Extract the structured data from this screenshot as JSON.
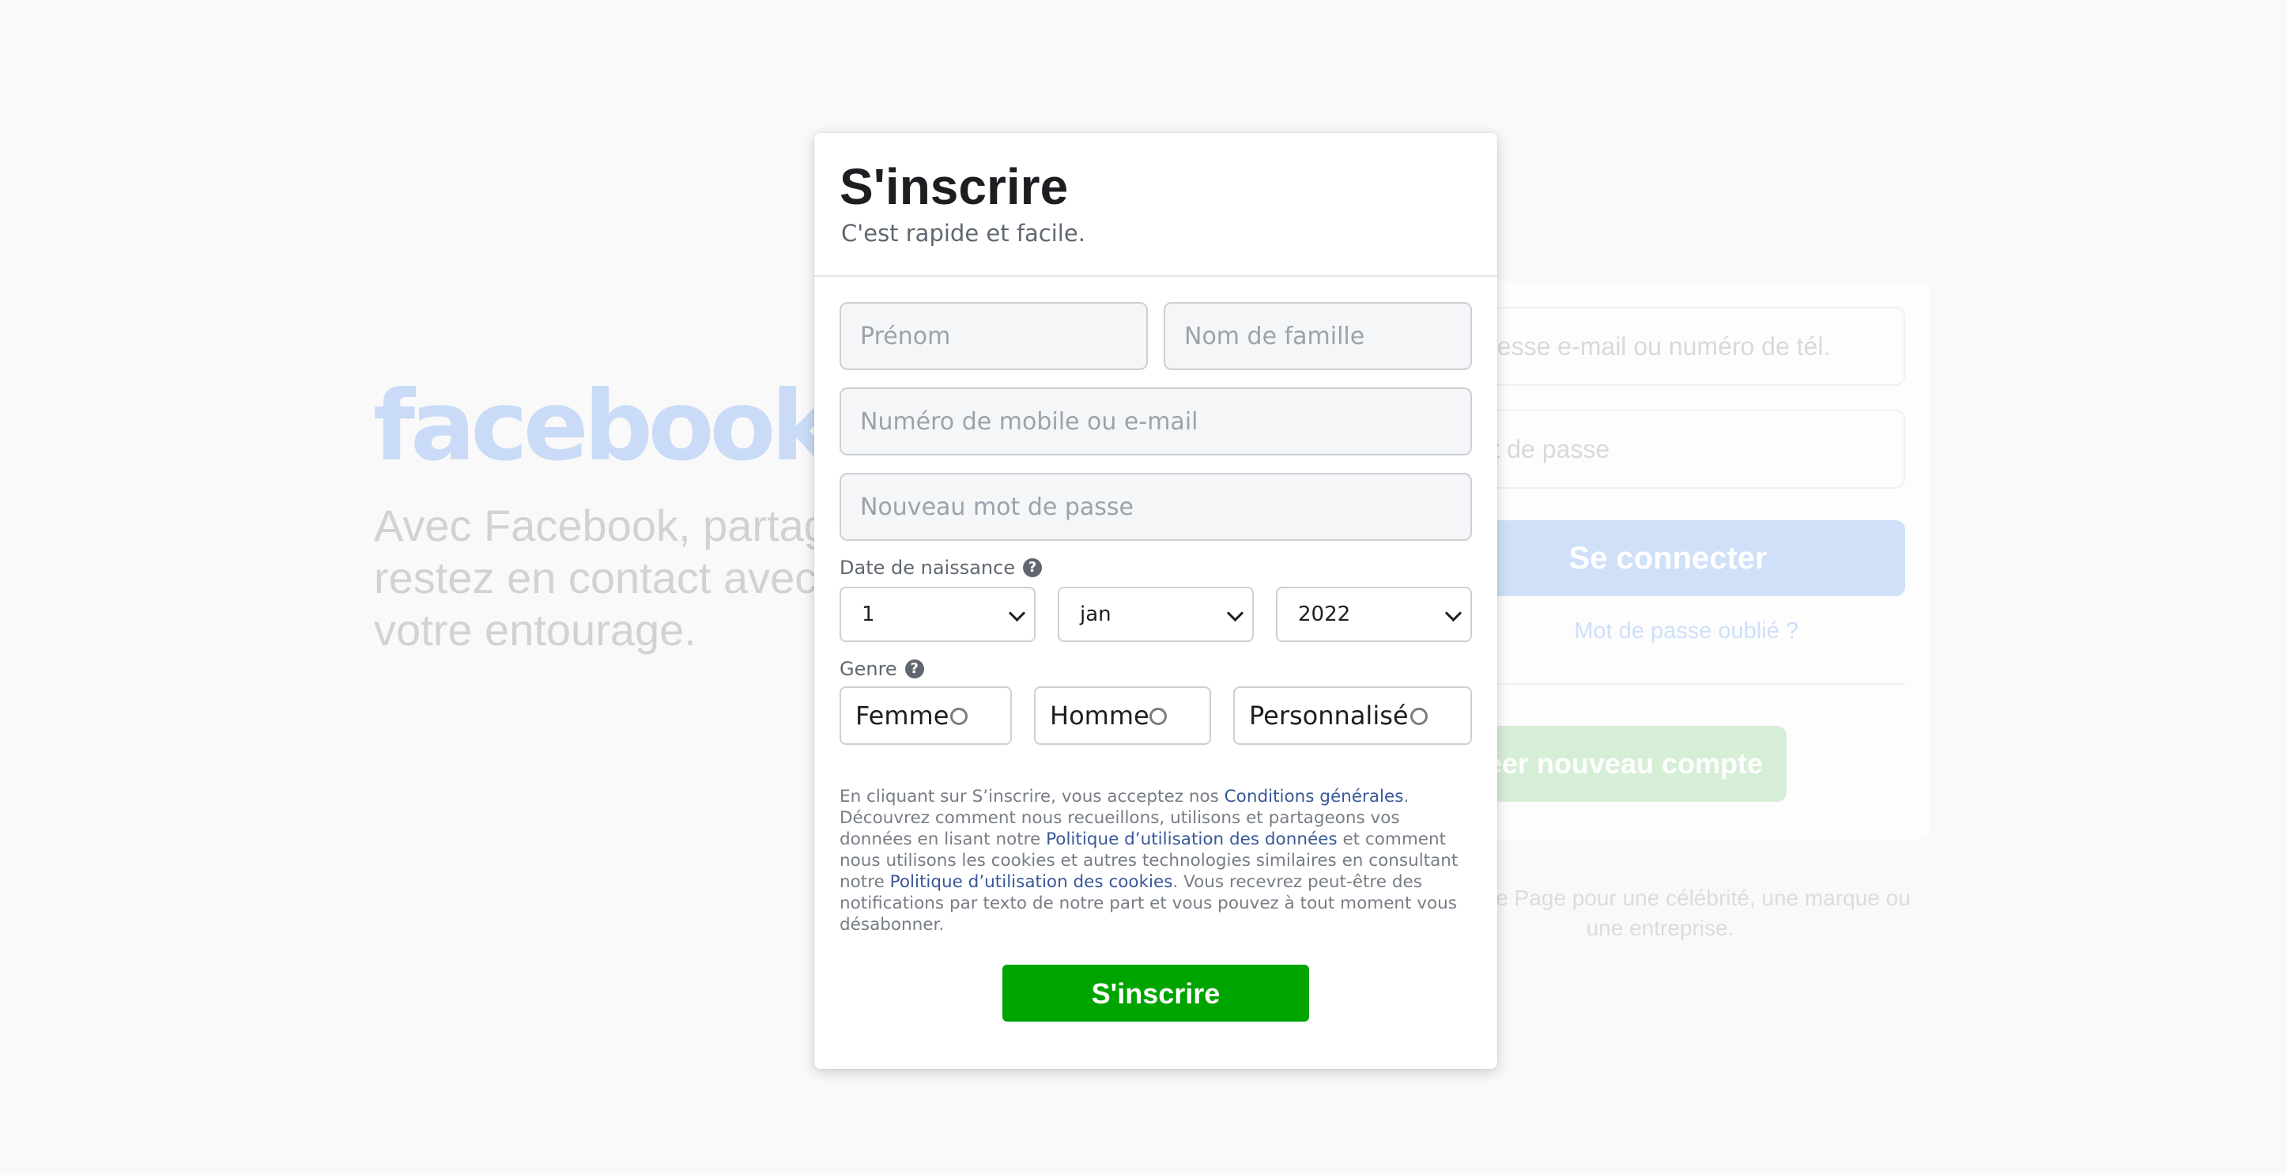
{
  "background": {
    "logo": "facebook",
    "tagline": "Avec Facebook, partagez et restez en contact avec votre entourage.",
    "login_email_placeholder": "Adresse e-mail ou numéro de tél.",
    "login_password_placeholder": "Mot de passe",
    "login_button": "Se connecter",
    "forgot_password": "Mot de passe oublié ?",
    "create_account": "Créer nouveau compte",
    "page_text": "Créer une Page pour une célébrité, une marque ou une entreprise."
  },
  "modal": {
    "title": "S'inscrire",
    "subtitle": "C'est rapide et facile.",
    "first_name_placeholder": "Prénom",
    "last_name_placeholder": "Nom de famille",
    "contact_placeholder": "Numéro de mobile ou e-mail",
    "password_placeholder": "Nouveau mot de passe",
    "birthdate_label": "Date de naissance",
    "help_glyph": "?",
    "birthdate": {
      "day": "1",
      "month": "jan",
      "year": "2022"
    },
    "gender_label": "Genre",
    "gender_options": [
      "Femme",
      "Homme",
      "Personnalisé"
    ],
    "terms": {
      "t1": "En cliquant sur S’inscrire, vous acceptez nos ",
      "l1": "Conditions générales",
      "t2": ". Découvrez comment nous recueillons, utilisons et partageons vos données en lisant notre ",
      "l2": "Politique d’utilisation des données",
      "t3": " et comment nous utilisons les cookies et autres technologies similaires en consultant notre ",
      "l3": "Politique d’utilisation des cookies",
      "t4": ". Vous recevrez peut-être des notifications par texto de notre part et vous pouvez à tout moment vous désabonner."
    },
    "submit_label": "S'inscrire"
  },
  "colors": {
    "brand_blue": "#1877f2",
    "submit_green": "#00a400",
    "link_blue": "#385898"
  }
}
